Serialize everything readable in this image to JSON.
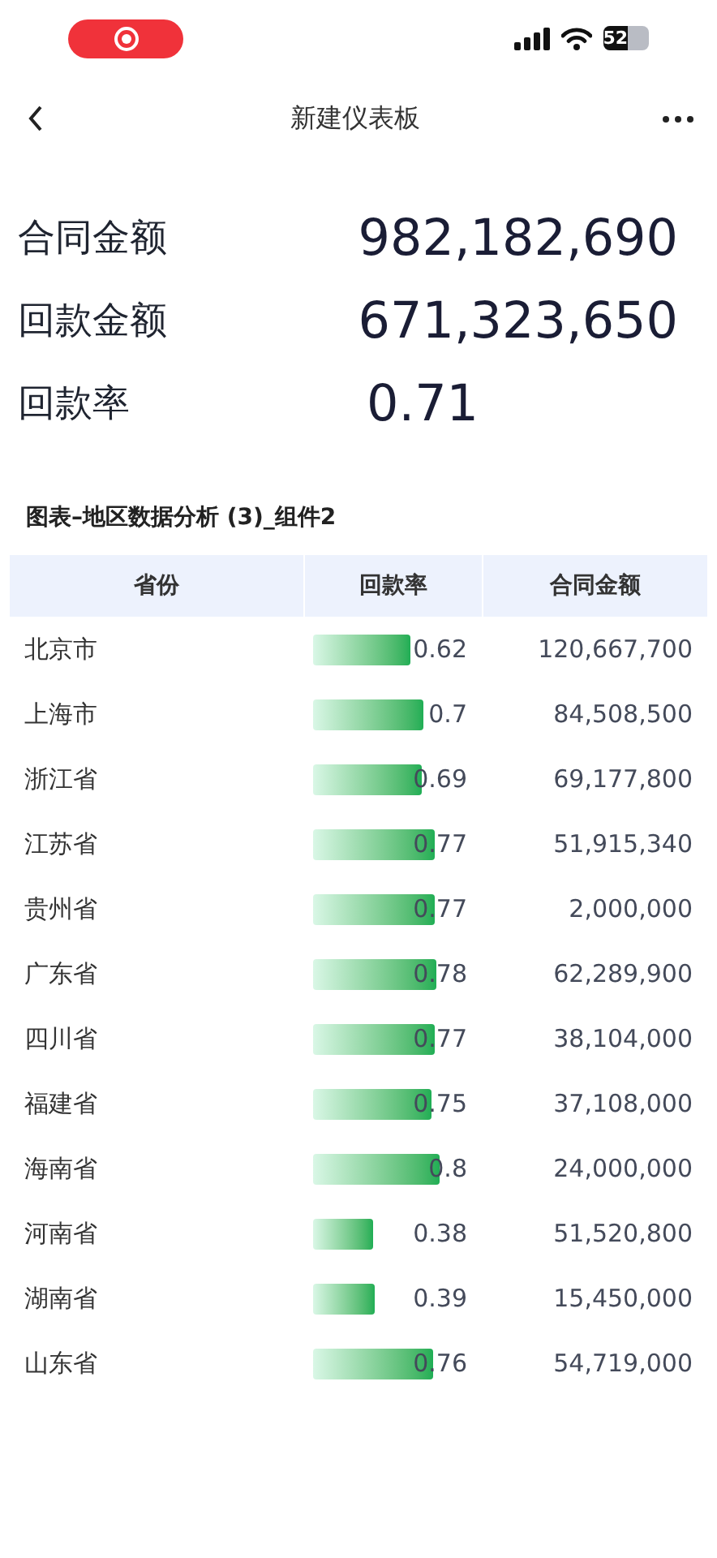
{
  "status_bar": {
    "battery": "52"
  },
  "nav": {
    "title": "新建仪表板"
  },
  "metrics": [
    {
      "label": "合同金额",
      "value": "982,182,690"
    },
    {
      "label": "回款金额",
      "value": "671,323,650"
    },
    {
      "label": "回款率",
      "value": "0.71"
    }
  ],
  "table": {
    "title": "图表–地区数据分析 (3)_组件2",
    "columns": [
      "省份",
      "回款率",
      "合同金额"
    ],
    "rows": [
      {
        "province": "北京市",
        "rate": "0.62",
        "amount": "120,667,700"
      },
      {
        "province": "上海市",
        "rate": "0.7",
        "amount": "84,508,500"
      },
      {
        "province": "浙江省",
        "rate": "0.69",
        "amount": "69,177,800"
      },
      {
        "province": "江苏省",
        "rate": "0.77",
        "amount": "51,915,340"
      },
      {
        "province": "贵州省",
        "rate": "0.77",
        "amount": "2,000,000"
      },
      {
        "province": "广东省",
        "rate": "0.78",
        "amount": "62,289,900"
      },
      {
        "province": "四川省",
        "rate": "0.77",
        "amount": "38,104,000"
      },
      {
        "province": "福建省",
        "rate": "0.75",
        "amount": "37,108,000"
      },
      {
        "province": "海南省",
        "rate": "0.8",
        "amount": "24,000,000"
      },
      {
        "province": "河南省",
        "rate": "0.38",
        "amount": "51,520,800"
      },
      {
        "province": "湖南省",
        "rate": "0.39",
        "amount": "15,450,000"
      },
      {
        "province": "山东省",
        "rate": "0.76",
        "amount": "54,719,000"
      }
    ]
  }
}
